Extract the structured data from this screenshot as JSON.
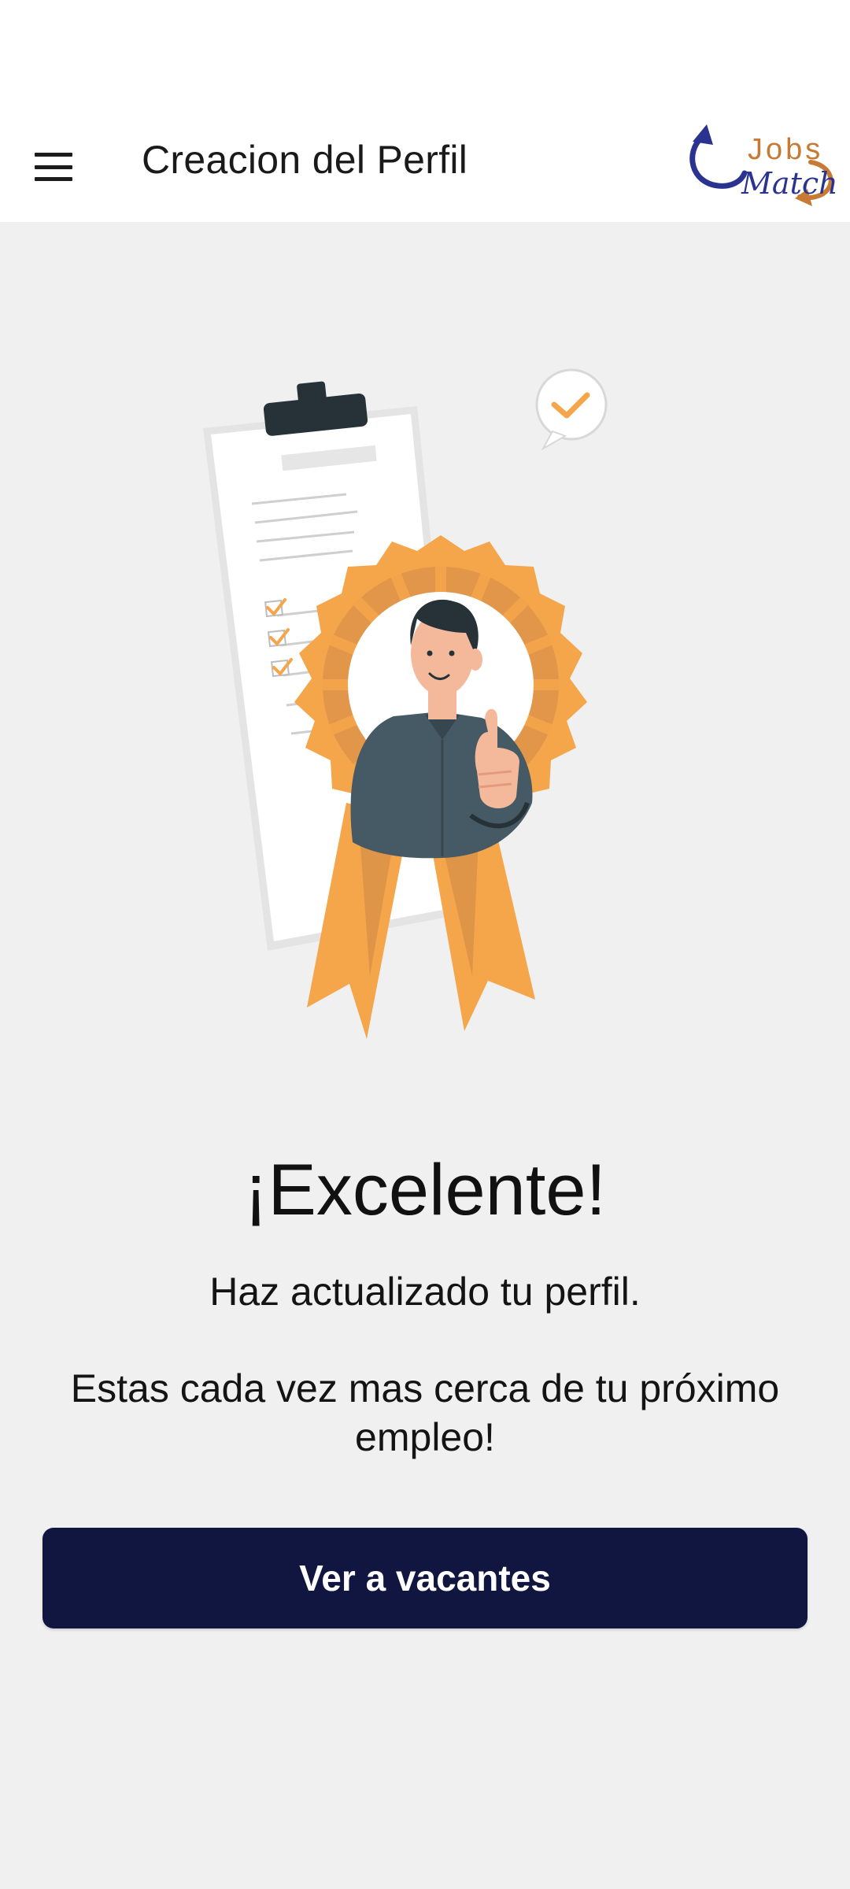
{
  "app_bar": {
    "title": "Creacion del Perfil",
    "menu_icon": "hamburger-menu-icon",
    "logo": {
      "line1": "Jobs",
      "line2": "Match"
    }
  },
  "main": {
    "headline": "¡Excelente!",
    "subtext": "Haz actualizado tu perfil.",
    "message": "Estas cada vez mas cerca de tu próximo empleo!",
    "button_label": "Ver a vacantes"
  },
  "colors": {
    "button_bg": "#111641",
    "background": "#f0f0f1",
    "app_bar_bg": "#ffffff",
    "logo_blue": "#2a3490",
    "logo_orange": "#c87a34",
    "ribbon_orange": "#f5a54a",
    "ribbon_dark": "#d08a48"
  }
}
